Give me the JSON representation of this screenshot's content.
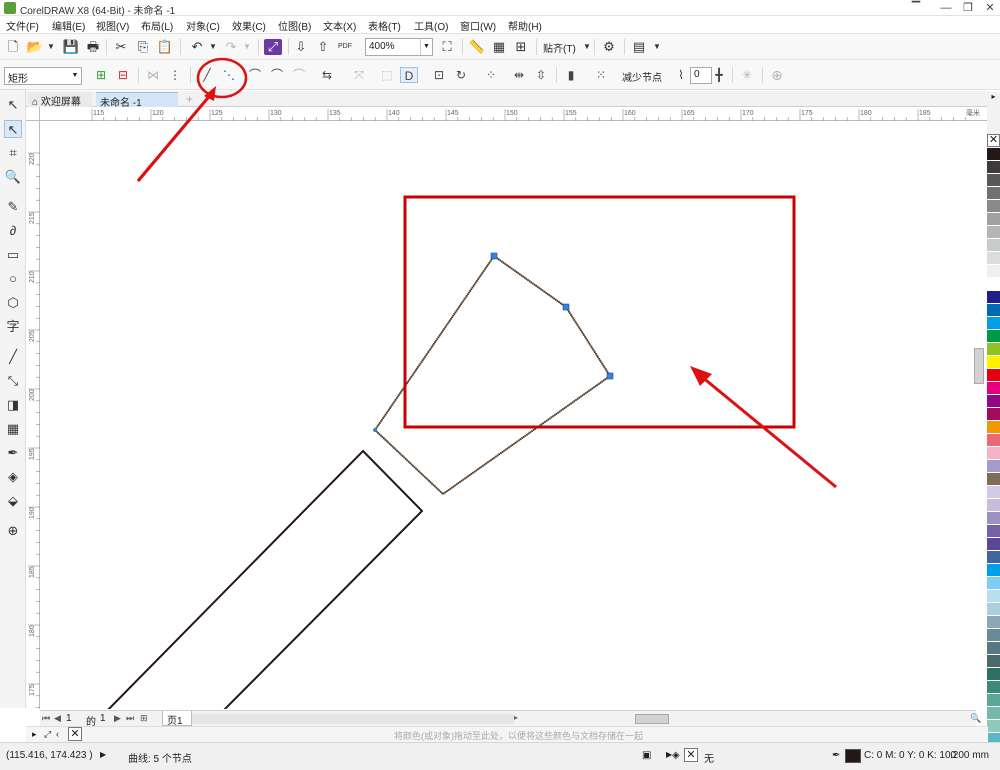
{
  "window": {
    "title": "CorelDRAW X8 (64-Bit) - 未命名 -1",
    "controls": [
      "minimize",
      "restore",
      "close"
    ]
  },
  "menu": [
    "文件(F)",
    "编辑(E)",
    "视图(V)",
    "布局(L)",
    "对象(C)",
    "效果(C)",
    "位图(B)",
    "文本(X)",
    "表格(T)",
    "工具(O)",
    "窗口(W)",
    "帮助(H)"
  ],
  "standard_toolbar": {
    "zoom_value": "400%",
    "snap_label": "贴齐(T)",
    "icons": [
      "new-icon",
      "open-icon",
      "save-icon",
      "print-icon",
      "cut-icon",
      "copy-icon",
      "paste-icon",
      "undo-icon",
      "redo-icon",
      "corel-connect-icon",
      "import-icon",
      "export-icon",
      "pdf-icon",
      "full-screen-icon",
      "rulers-icon",
      "grid-icon",
      "guidelines-icon",
      "options-icon",
      "launch-icon"
    ],
    "pdf_label": "PDF"
  },
  "property_bar": {
    "selection_mode": "矩形",
    "reduce_nodes_label": "减少节点",
    "curve_smoothness": "0"
  },
  "tabs": {
    "welcome": "欢迎屏幕",
    "document": "未命名 -1",
    "add": "+"
  },
  "rulers": {
    "horizontal_labels": [
      "115",
      "120",
      "125",
      "130",
      "135",
      "140",
      "145",
      "150",
      "155",
      "160",
      "165",
      "170",
      "175",
      "180",
      "185"
    ],
    "horizontal_unit": "毫米",
    "vertical_labels": [
      "220",
      "215",
      "210",
      "205",
      "200",
      "195",
      "190",
      "185",
      "180",
      "175"
    ]
  },
  "page_nav": {
    "current": "1",
    "of_label": "的",
    "total": "1",
    "page_tab": "页1"
  },
  "color_hint": "将颜色(或对象)拖动至此处，以便将这些颜色与文档存储在一起",
  "status": {
    "coordinates": "(115.416, 174.423 )",
    "object_info": "曲线: 5 个节点",
    "fill_label": "无",
    "outline_color": "C: 0 M: 0 Y: 0 K: 100",
    "outline_width": ".200 mm"
  },
  "colors": {
    "accent": "#cc0000",
    "node": "#3a7fd8",
    "outline": "#231815"
  },
  "palette": [
    "#ffffff",
    "#231815",
    "#3e3a39",
    "#595757",
    "#727171",
    "#898989",
    "#9fa0a0",
    "#b5b5b6",
    "#c9caca",
    "#dcdddd",
    "#efefef",
    "#ffffff",
    "#1d2088",
    "#0068b7",
    "#00a0e9",
    "#009944",
    "#8fc31f",
    "#fff100",
    "#e60012",
    "#e4007f",
    "#920783",
    "#a40b5d",
    "#f39800",
    "#eb6877",
    "#f4b4c8",
    "#a59aca",
    "#7e6b5a",
    "#d3cbe5",
    "#c9bcdd",
    "#9d91c4",
    "#7461a7",
    "#5a4797",
    "#41669f",
    "#00a0e9",
    "#7ecef4",
    "#b9def0",
    "#aacfe1",
    "#8ea7b8",
    "#6b8a99",
    "#56787f",
    "#4a6b6b",
    "#2f6f5f",
    "#3c8a78",
    "#5ba796",
    "#73b8a8",
    "#8ec9bc",
    "#58b8c6",
    "#3aa3b9"
  ],
  "toolbox_icons": [
    "pick-tool-icon",
    "shape-tool-icon",
    "crop-tool-icon",
    "zoom-tool-icon",
    "freehand-tool-icon",
    "artistic-media-icon",
    "rectangle-tool-icon",
    "ellipse-tool-icon",
    "polygon-tool-icon",
    "text-tool-icon",
    "parallel-dimension-icon",
    "connector-tool-icon",
    "drop-shadow-icon",
    "transparency-icon",
    "eyedropper-icon",
    "interactive-fill-icon",
    "smart-fill-icon",
    "add-tool-icon"
  ],
  "toolbox_glyphs": [
    "↖",
    "↖",
    "⌗",
    "🔍",
    "✎",
    "∂",
    "▭",
    "○",
    "⬡",
    "字",
    "╱",
    "⤡",
    "◨",
    "▦",
    "✒",
    "◈",
    "⬙",
    "⊕"
  ]
}
